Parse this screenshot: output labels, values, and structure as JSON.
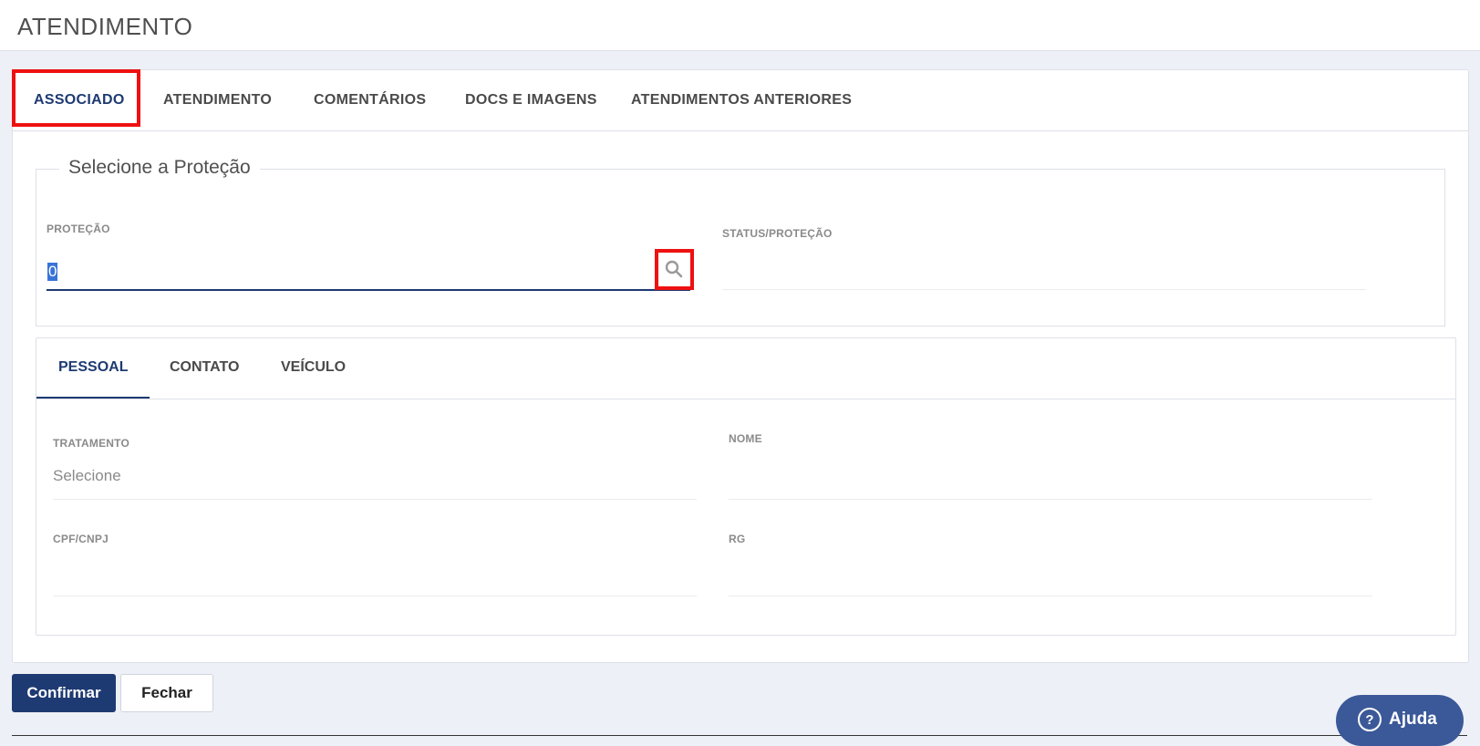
{
  "page": {
    "title": "ATENDIMENTO"
  },
  "tabs": [
    {
      "label": "ASSOCIADO",
      "active": true
    },
    {
      "label": "ATENDIMENTO",
      "active": false
    },
    {
      "label": "COMENTÁRIOS",
      "active": false
    },
    {
      "label": "DOCS E IMAGENS",
      "active": false
    },
    {
      "label": "ATENDIMENTOS ANTERIORES",
      "active": false
    }
  ],
  "protection_section": {
    "legend": "Selecione a Proteção",
    "protecao": {
      "label": "PROTEÇÃO",
      "value": "0",
      "search_icon": "search-icon"
    },
    "status": {
      "label": "STATUS/PROTEÇÃO",
      "value": ""
    }
  },
  "sub_tabs": [
    {
      "label": "PESSOAL",
      "active": true
    },
    {
      "label": "CONTATO",
      "active": false
    },
    {
      "label": "VEÍCULO",
      "active": false
    }
  ],
  "personal": {
    "tratamento": {
      "label": "TRATAMENTO",
      "value": "Selecione"
    },
    "nome": {
      "label": "NOME",
      "value": ""
    },
    "cpf": {
      "label": "CPF/CNPJ",
      "value": ""
    },
    "rg": {
      "label": "RG",
      "value": ""
    }
  },
  "actions": {
    "confirm": "Confirmar",
    "close": "Fechar"
  },
  "help": {
    "label": "Ajuda",
    "icon": "question-circle-icon"
  },
  "colors": {
    "primary": "#1e3a72",
    "highlight": "#ee1111",
    "help": "#3b5998"
  }
}
